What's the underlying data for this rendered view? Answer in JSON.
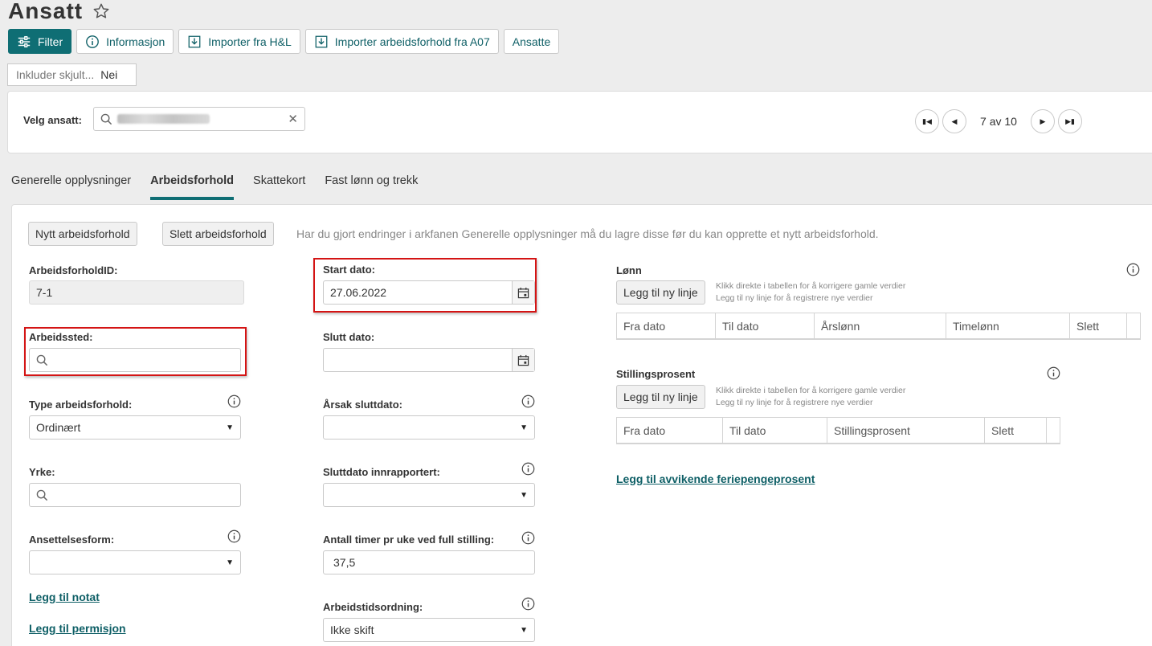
{
  "page": {
    "title": "Ansatt"
  },
  "toolbar": {
    "filter": "Filter",
    "info": "Informasjon",
    "import_hl": "Importer fra H&L",
    "import_a07": "Importer arbeidsforhold fra A07",
    "employees": "Ansatte"
  },
  "filter_chip": {
    "label": "Inkluder skjult...",
    "value": "Nei"
  },
  "employee_select": {
    "label": "Velg ansatt:",
    "pager_text": "7 av 10"
  },
  "tabs": [
    "Generelle opplysninger",
    "Arbeidsforhold",
    "Skattekort",
    "Fast lønn og trekk"
  ],
  "employment": {
    "new_button": "Nytt arbeidsforhold",
    "delete_button": "Slett arbeidsforhold",
    "hint": "Har du gjort endringer i arkfanen Generelle opplysninger må du lagre disse før du kan opprette et nytt arbeidsforhold.",
    "id_label": "ArbeidsforholdID:",
    "id_value": "7-1",
    "workplace_label": "Arbeidssted:",
    "type_label": "Type arbeidsforhold:",
    "type_value": "Ordinært",
    "occupation_label": "Yrke:",
    "employment_form_label": "Ansettelsesform:",
    "add_note": "Legg til notat",
    "add_leave": "Legg til permisjon",
    "start_label": "Start dato:",
    "start_value": "27.06.2022",
    "end_label": "Slutt dato:",
    "end_reason_label": "Årsak sluttdato:",
    "end_reported_label": "Sluttdato innrapportert:",
    "hours_label": "Antall timer pr uke ved full stilling:",
    "hours_value": "37,5",
    "worktime_label": "Arbeidstidsordning:",
    "worktime_value": "Ikke skift"
  },
  "salary": {
    "title": "Lønn",
    "add_line": "Legg til ny linje",
    "hint1": "Klikk direkte i tabellen for å korrigere gamle verdier",
    "hint2": "Legg til ny linje for å registrere nye verdier",
    "columns": [
      "Fra dato",
      "Til dato",
      "Årslønn",
      "Timelønn",
      "Slett"
    ]
  },
  "position": {
    "title": "Stillingsprosent",
    "add_line": "Legg til ny linje",
    "hint1": "Klikk direkte i tabellen for å korrigere gamle verdier",
    "hint2": "Legg til ny linje for å registrere nye verdier",
    "columns": [
      "Fra dato",
      "Til dato",
      "Stillingsprosent",
      "Slett"
    ]
  },
  "holiday_link": "Legg til avvikende feriepengeprosent",
  "colors": {
    "accent": "#0f6e74",
    "highlight": "#d41414"
  }
}
